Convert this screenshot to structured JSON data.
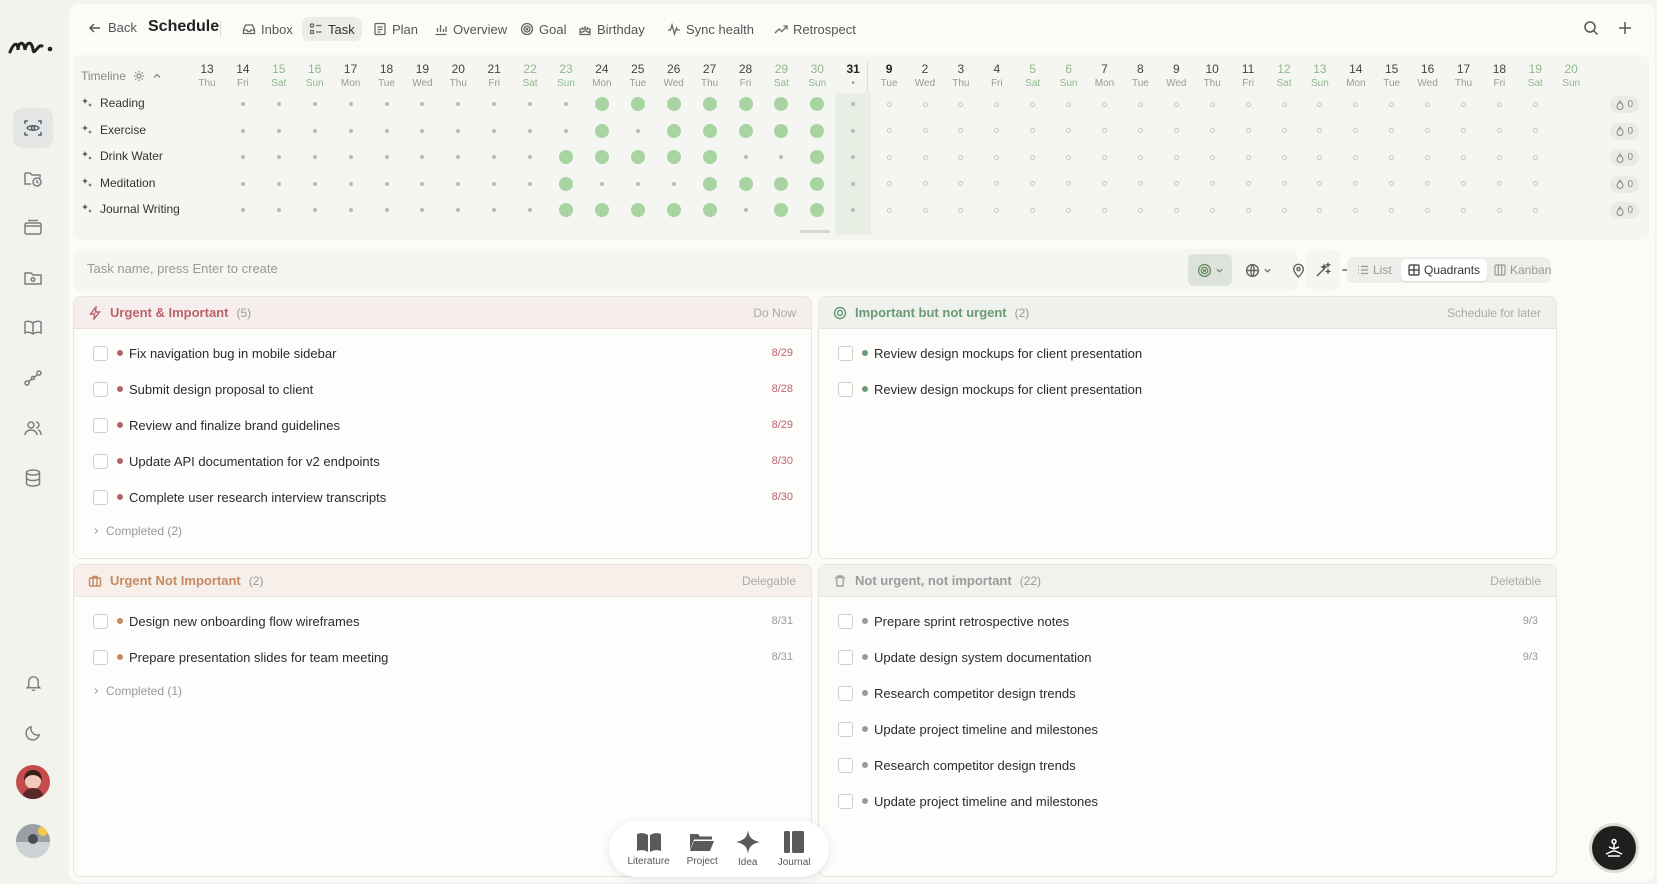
{
  "nav": {
    "back": "Back",
    "title": "Schedule",
    "tabs": [
      {
        "label": "Inbox",
        "icon": "inbox-icon"
      },
      {
        "label": "Task",
        "icon": "task-icon"
      },
      {
        "label": "Plan",
        "icon": "plan-icon"
      },
      {
        "label": "Overview",
        "icon": "chart-icon"
      },
      {
        "label": "Goal",
        "icon": "target-icon"
      },
      {
        "label": "Birthday",
        "icon": "cake-icon"
      },
      {
        "label": "Sync health",
        "icon": "pulse-icon"
      },
      {
        "label": "Retrospect",
        "icon": "trend-icon"
      }
    ],
    "active_tab": "Task"
  },
  "timeline": {
    "label": "Timeline",
    "days": [
      {
        "n": "13",
        "w": "Thu"
      },
      {
        "n": "14",
        "w": "Fri"
      },
      {
        "n": "15",
        "w": "Sat"
      },
      {
        "n": "16",
        "w": "Sun"
      },
      {
        "n": "17",
        "w": "Mon"
      },
      {
        "n": "18",
        "w": "Tue"
      },
      {
        "n": "19",
        "w": "Wed"
      },
      {
        "n": "20",
        "w": "Thu"
      },
      {
        "n": "21",
        "w": "Fri"
      },
      {
        "n": "22",
        "w": "Sat"
      },
      {
        "n": "23",
        "w": "Sun"
      },
      {
        "n": "24",
        "w": "Mon"
      },
      {
        "n": "25",
        "w": "Tue"
      },
      {
        "n": "26",
        "w": "Wed"
      },
      {
        "n": "27",
        "w": "Thu"
      },
      {
        "n": "28",
        "w": "Fri"
      },
      {
        "n": "29",
        "w": "Sat"
      },
      {
        "n": "30",
        "w": "Sun"
      },
      {
        "n": "31",
        "w": "•"
      },
      {
        "n": "9",
        "w": "Tue"
      },
      {
        "n": "2",
        "w": "Wed"
      },
      {
        "n": "3",
        "w": "Thu"
      },
      {
        "n": "4",
        "w": "Fri"
      },
      {
        "n": "5",
        "w": "Sat"
      },
      {
        "n": "6",
        "w": "Sun"
      },
      {
        "n": "7",
        "w": "Mon"
      },
      {
        "n": "8",
        "w": "Tue"
      },
      {
        "n": "9",
        "w": "Wed"
      },
      {
        "n": "10",
        "w": "Thu"
      },
      {
        "n": "11",
        "w": "Fri"
      },
      {
        "n": "12",
        "w": "Sat"
      },
      {
        "n": "13",
        "w": "Sun"
      },
      {
        "n": "14",
        "w": "Mon"
      },
      {
        "n": "15",
        "w": "Tue"
      },
      {
        "n": "16",
        "w": "Wed"
      },
      {
        "n": "17",
        "w": "Thu"
      },
      {
        "n": "18",
        "w": "Fri"
      },
      {
        "n": "19",
        "w": "Sat"
      },
      {
        "n": "20",
        "w": "Sun"
      }
    ],
    "habits": [
      {
        "name": "Reading",
        "done": [
          11,
          12,
          13,
          14,
          15,
          16,
          17
        ],
        "streak": "0"
      },
      {
        "name": "Exercise",
        "done": [
          11,
          13,
          14,
          15,
          16,
          17
        ],
        "streak": "0"
      },
      {
        "name": "Drink Water",
        "done": [
          10,
          11,
          12,
          13,
          14,
          17
        ],
        "streak": "0"
      },
      {
        "name": "Meditation",
        "done": [
          10,
          14,
          15,
          16,
          17
        ],
        "streak": "0"
      },
      {
        "name": "Journal Writing",
        "done": [
          10,
          11,
          12,
          13,
          14,
          16,
          17
        ],
        "streak": "0"
      }
    ]
  },
  "create": {
    "placeholder": "Task name, press Enter to create"
  },
  "views": {
    "list": "List",
    "quadrants": "Quadrants",
    "kanban": "Kanban"
  },
  "quadrants": {
    "q1": {
      "title": "Urgent & Important",
      "count": "(5)",
      "hint": "Do Now",
      "color": "#b9636b",
      "tasks": [
        {
          "title": "Fix navigation bug in mobile sidebar",
          "date": "8/29"
        },
        {
          "title": "Submit design proposal to client",
          "date": "8/28"
        },
        {
          "title": "Review and finalize brand guidelines",
          "date": "8/29"
        },
        {
          "title": "Update API documentation for v2 endpoints",
          "date": "8/30"
        },
        {
          "title": "Complete user research interview transcripts",
          "date": "8/30"
        }
      ],
      "completed": "Completed (2)"
    },
    "q2": {
      "title": "Important but not urgent",
      "count": "(2)",
      "hint": "Schedule for later",
      "color": "#6b9a77",
      "tasks": [
        {
          "title": "Review design mockups for client presentation",
          "date": ""
        },
        {
          "title": "Review design mockups for client presentation",
          "date": ""
        }
      ]
    },
    "q3": {
      "title": "Urgent Not Important",
      "count": "(2)",
      "hint": "Delegable",
      "color": "#c58a62",
      "tasks": [
        {
          "title": "Design new onboarding flow wireframes",
          "date": "8/31"
        },
        {
          "title": "Prepare presentation slides for team meeting",
          "date": "8/31"
        }
      ],
      "completed": "Completed (1)"
    },
    "q4": {
      "title": "Not urgent, not important",
      "count": "(22)",
      "hint": "Deletable",
      "color": "#9a9a9a",
      "tasks": [
        {
          "title": "Prepare sprint retrospective notes",
          "date": "9/3"
        },
        {
          "title": "Update design system documentation",
          "date": "9/3"
        },
        {
          "title": "Research competitor design trends",
          "date": ""
        },
        {
          "title": "Update project timeline and milestones",
          "date": ""
        },
        {
          "title": "Research competitor design trends",
          "date": ""
        },
        {
          "title": "Update project timeline and milestones",
          "date": ""
        }
      ]
    }
  },
  "dock": [
    {
      "label": "Literature",
      "icon": "book-icon"
    },
    {
      "label": "Project",
      "icon": "folder-icon"
    },
    {
      "label": "Idea",
      "icon": "sparkle-icon"
    },
    {
      "label": "Journal",
      "icon": "journal-icon"
    }
  ]
}
